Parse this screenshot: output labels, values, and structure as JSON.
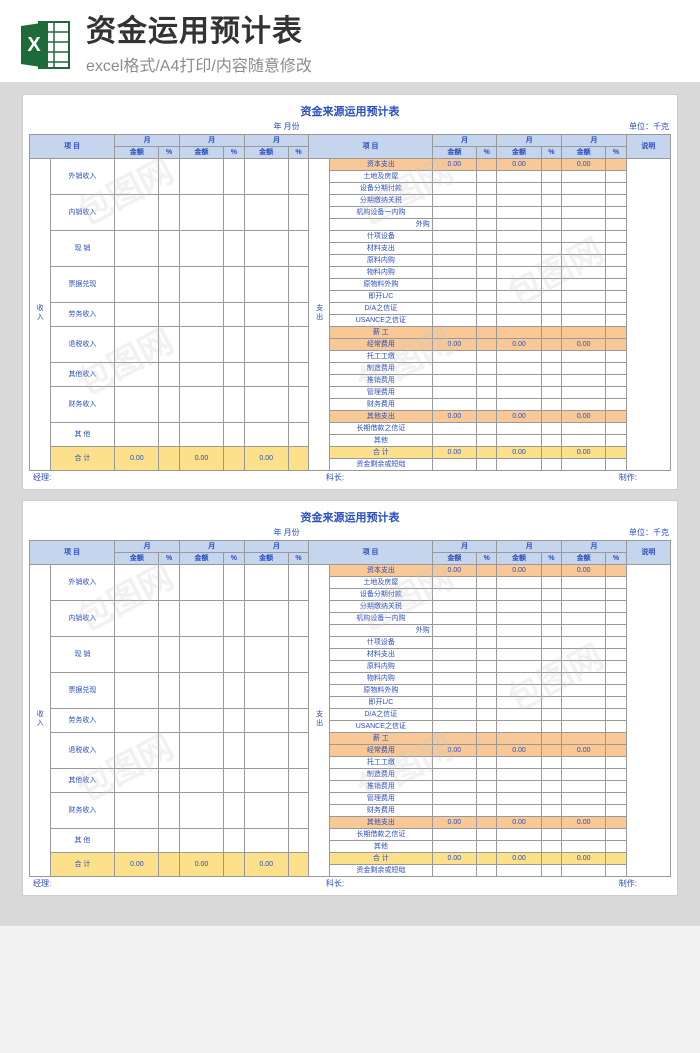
{
  "header": {
    "main_title": "资金运用预计表",
    "sub_title": "excel格式/A4打印/内容随意修改",
    "icon_letter": "X"
  },
  "sheet": {
    "title": "资金来源运用预计表",
    "date_label": "年  月份",
    "unit_label": "单位：千克",
    "col_item": "项  目",
    "col_month": "月",
    "col_amount": "金额",
    "col_pct": "%",
    "col_desc": "说明",
    "left_header": "收入",
    "right_header": "支出",
    "zero": "0.00",
    "left_rows": [
      "外销收入",
      "内销收入",
      "现  销",
      "票据兑现",
      "劳务收入",
      "退税收入",
      "其他收入",
      "财务收入",
      "其  他"
    ],
    "total_label": "合  计",
    "right_rows": [
      {
        "lbl": "资本支出",
        "cls": "cell-orange",
        "sum": true
      },
      {
        "lbl": "土地及房屋",
        "cls": "indent1"
      },
      {
        "lbl": "设备分期付款",
        "cls": "indent1"
      },
      {
        "lbl": "分期缴纳关税",
        "cls": "indent1"
      },
      {
        "lbl": "机构设备一内购",
        "cls": "indent1"
      },
      {
        "lbl": "外购",
        "cls": "indent1",
        "right": true
      },
      {
        "lbl": "什项设备",
        "cls": "indent1"
      },
      {
        "lbl": "材料支出",
        "cls": "indent1"
      },
      {
        "lbl": "原料内购",
        "cls": "indent1"
      },
      {
        "lbl": "物料内购",
        "cls": "indent1"
      },
      {
        "lbl": "原物料外购",
        "cls": "indent1"
      },
      {
        "lbl": "即开L/C",
        "cls": "indent1"
      },
      {
        "lbl": "D/A之信证",
        "cls": "indent1"
      },
      {
        "lbl": "USANCE之信证",
        "cls": "indent1"
      },
      {
        "lbl": "薪  工",
        "cls": "cell-orange"
      },
      {
        "lbl": "经常费用",
        "cls": "cell-orange",
        "sum": true
      },
      {
        "lbl": "托工工缴",
        "cls": "indent1"
      },
      {
        "lbl": "制造费用",
        "cls": "indent1"
      },
      {
        "lbl": "推销费用",
        "cls": "indent1"
      },
      {
        "lbl": "管理费用",
        "cls": "indent1"
      },
      {
        "lbl": "财务费用",
        "cls": "indent1"
      },
      {
        "lbl": "其他支出",
        "cls": "cell-orange",
        "sum": true
      },
      {
        "lbl": "长期借款之信证",
        "cls": "indent1"
      },
      {
        "lbl": "其他",
        "cls": "indent1"
      },
      {
        "lbl": "合  计",
        "cls": "cell-yellow",
        "sum": true
      },
      {
        "lbl": "资金剩余或短绌",
        "cls": ""
      }
    ],
    "footer": {
      "l1": "经理:",
      "l2": "科长:",
      "l3": "制作:"
    }
  },
  "watermark": "包图网"
}
